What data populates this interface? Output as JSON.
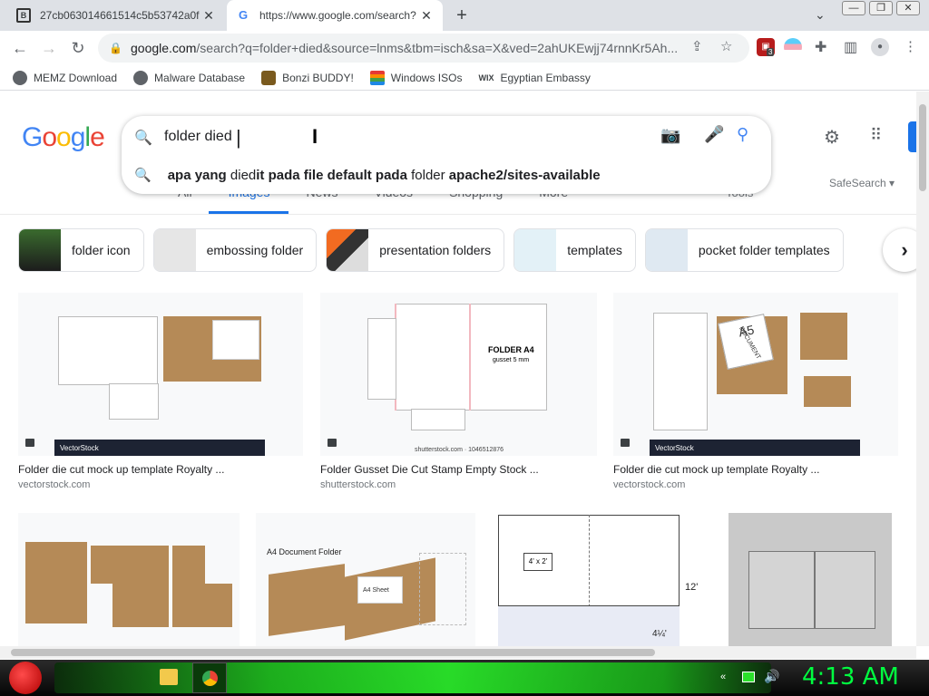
{
  "browser": {
    "tabs": [
      {
        "title": "27cb063014661514c5b53742a0f",
        "active": false
      },
      {
        "title": "https://www.google.com/search?",
        "active": true
      }
    ],
    "new_tab": "+",
    "url_host": "google.com",
    "url_rest": "/search?q=folder+died&source=lnms&tbm=isch&sa=X&ved=2ahUKEwjj74rnnKr5Ah...",
    "ext_badge": "3",
    "bookmarks": [
      "MEMZ Download",
      "Malware Database",
      "Bonzi BUDDY!",
      "Windows ISOs",
      "Egyptian Embassy"
    ]
  },
  "google": {
    "logo": [
      "G",
      "o",
      "o",
      "g",
      "l",
      "e"
    ],
    "logo_colors": [
      "#4285f4",
      "#ea4335",
      "#fbbc05",
      "#4285f4",
      "#34a853",
      "#ea4335"
    ],
    "query": "folder died",
    "suggestion": {
      "p1": "apa yang ",
      "p2": "died",
      "p3": "it pada file default pada ",
      "p4": "folder",
      "p5": " apache2/sites-available"
    },
    "hidden_tabs": [
      "All",
      "Images",
      "News",
      "Videos",
      "Shopping",
      "More"
    ],
    "tools": "Tools",
    "safesearch": "SafeSearch ▾",
    "chips": [
      "folder icon",
      "embossing folder",
      "presentation folders",
      "templates",
      "pocket folder templates"
    ],
    "results": [
      {
        "caption": "Folder die cut mock up template Royalty ...",
        "source": "vectorstock.com"
      },
      {
        "caption": "Folder Gusset Die Cut Stamp Empty Stock ...",
        "source": "shutterstock.com"
      },
      {
        "caption": "Folder die cut mock up template Royalty ...",
        "source": "vectorstock.com"
      }
    ],
    "img_text": {
      "folder_a4": "FOLDER A4",
      "gusset": "gusset 5 mm",
      "shutter_id": "shutterstock.com · 1046512876",
      "vectorstock": "VectorStock",
      "a5": "A5",
      "document": "DOCUMENT",
      "a4_doc_folder": "A4 Document Folder",
      "a4_sheet": "A4 Sheet",
      "dim_4x2": "4' x 2'",
      "dim_12": "12'",
      "dim_4q": "4¼'"
    }
  },
  "taskbar": {
    "clock": "4:13 AM"
  }
}
